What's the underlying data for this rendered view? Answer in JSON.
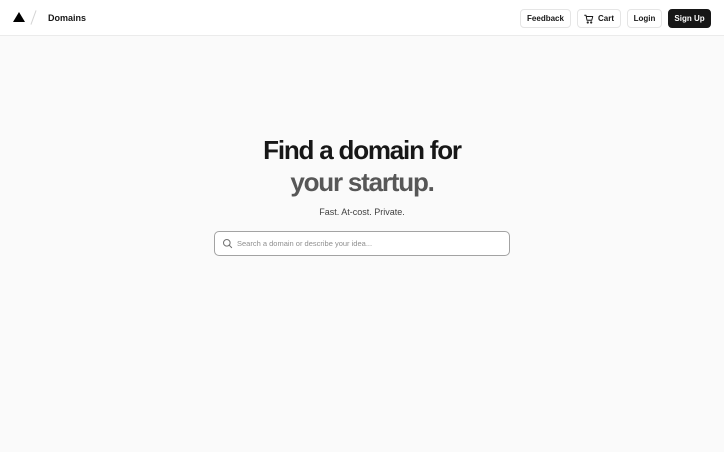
{
  "header": {
    "logo_icon": "triangle-logo-icon",
    "breadcrumb": "Domains",
    "buttons": {
      "feedback": "Feedback",
      "cart": "Cart",
      "cart_icon": "cart-icon",
      "login": "Login",
      "signup": "Sign Up"
    }
  },
  "hero": {
    "title_line1": "Find a domain for",
    "title_line2": "your startup.",
    "subtitle": "Fast. At-cost. Private."
  },
  "search": {
    "value": "",
    "placeholder": "Search a domain or describe your idea...",
    "icon": "search-icon"
  },
  "colors": {
    "background": "#fafafa",
    "primary_button": "#171717",
    "title_secondary": "#575757"
  }
}
